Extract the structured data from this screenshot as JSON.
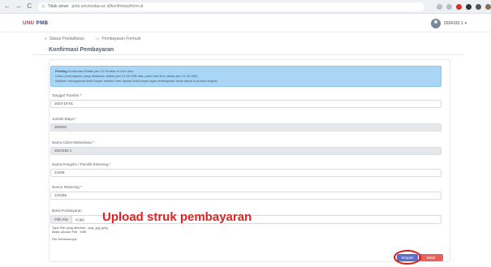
{
  "browser": {
    "back": "←",
    "forward": "→",
    "reload": "C",
    "security": "Tidak aman",
    "url": "pmb.universitas.ac.id/konfirmasi/form.id"
  },
  "header": {
    "logo_red": "UNU",
    "logo_blue": "PMB",
    "user_name": "2024193 1",
    "caret": "▾"
  },
  "nav": {
    "status_label": "Status Pendaftaran",
    "form_label": "Pembayaran Formulir"
  },
  "page": {
    "title": "Konfirmasi Pembayaran"
  },
  "alert": {
    "line1_bold": "Penting",
    "line1": " Konfirmasi Diatas jam 21.00 atau di hari Libur",
    "line2": "Untuk pembayaran yang dilakukan diatas jam 21:00 WIB atau pada hari libur diatas jam 11.00 WIB,",
    "line3": "silahkan mengupload bukti bayar melalui form upload bukti bayar agar pembayaran anda dapat di proses segera."
  },
  "form": {
    "tanggal_label": "Tanggal Transfer *",
    "tanggal_value": "2023-10-01",
    "jumlah_label": "Jumlah Biaya *",
    "jumlah_value": "300000",
    "nama_label": "Nama Calon Mahasiswa *",
    "nama_value": "2024193 1",
    "pengirim_label": "Nama Pengirim / Pemilik Rekening *",
    "pengirim_value": "24105",
    "rekening_label": "Nomor Rekening *",
    "rekening_value": "123456",
    "bukti_label": "Bukti Pembayaran",
    "file_button": "Pilih File",
    "file_name": "ui.jpg",
    "hint_type": "Type File yang diterima : png, jpg, jpeg",
    "hint_size": "Maks Ukuran File : 1Mb",
    "hint_prev": "File Sebelumnya :"
  },
  "annotation": "Upload struk pembayaran",
  "buttons": {
    "save": "Simpan",
    "cancel": "Batal"
  },
  "colors": {
    "annotation": "#e02424",
    "save": "#5b6fc7",
    "cancel": "#e8615a",
    "alert_bg": "#a9d6f5"
  }
}
